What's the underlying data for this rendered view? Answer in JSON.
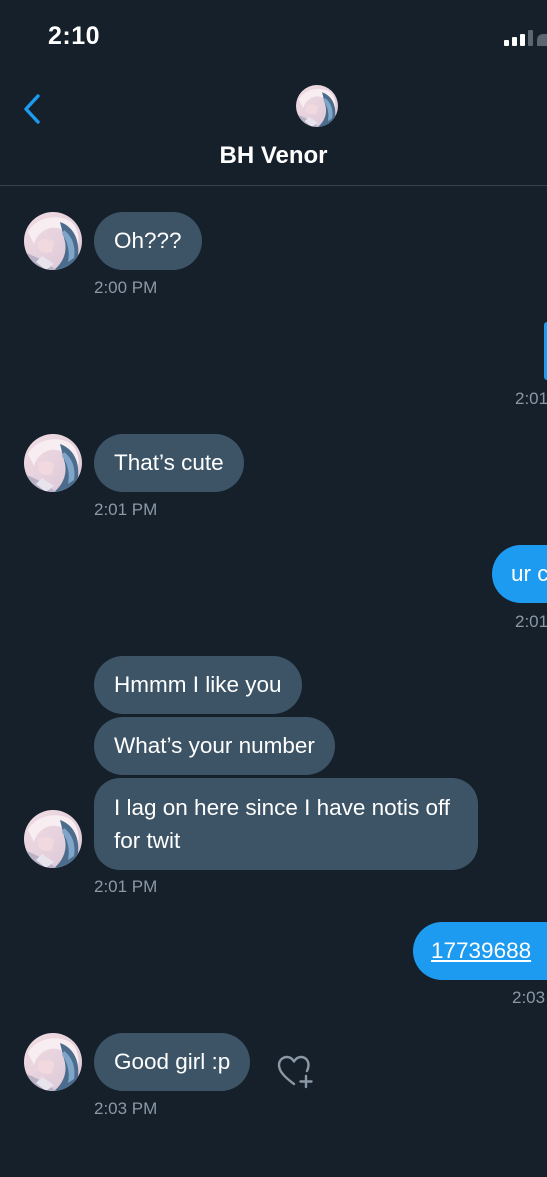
{
  "status": {
    "time": "2:10"
  },
  "header": {
    "title": "BH Venor"
  },
  "messages": {
    "m1": {
      "text": "Oh???",
      "time": "2:00 PM"
    },
    "m2": {
      "time": "2:01"
    },
    "m3": {
      "text": "That’s cute",
      "time": "2:01 PM"
    },
    "m4": {
      "text": "ur c",
      "time": "2:01"
    },
    "m5": {
      "text": "Hmmm I like you"
    },
    "m6": {
      "text": "What’s your number"
    },
    "m7": {
      "text": "I lag on here since I have notis off for twit",
      "time": "2:01 PM"
    },
    "m8": {
      "text": "17739688",
      "time": "2:03"
    },
    "m9": {
      "text": "Good girl :p",
      "time": "2:03 PM"
    }
  },
  "icons": {
    "back": "chevron-left-icon",
    "react": "heart-plus-icon",
    "signal": "signal-bars-icon"
  },
  "colors": {
    "background": "#15202b",
    "incoming_bubble": "#3d5466",
    "outgoing_bubble": "#1d9bf0",
    "accent": "#1d9bf0",
    "timestamp": "#8b98a5"
  }
}
